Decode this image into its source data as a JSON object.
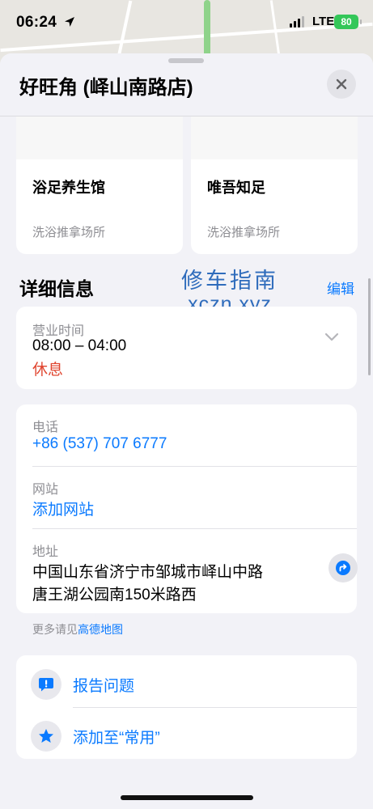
{
  "status_bar": {
    "time": "06:24",
    "network": "LTE",
    "battery": "80"
  },
  "place": {
    "title": "好旺角 (峄山南路店)"
  },
  "nearby": [
    {
      "name": "浴足养生馆",
      "category": "洗浴推拿场所"
    },
    {
      "name": "唯吾知足",
      "category": "洗浴推拿场所"
    }
  ],
  "details": {
    "title": "详细信息",
    "edit_label": "编辑",
    "hours": {
      "label": "营业时间",
      "value": "08:00 – 04:00",
      "status": "休息"
    },
    "phone": {
      "label": "电话",
      "value": "+86 (537) 707 6777"
    },
    "website": {
      "label": "网站",
      "value": "添加网站"
    },
    "address": {
      "label": "地址",
      "line1": "中国山东省济宁市邹城市峄山中路",
      "line2": "唐王湖公园南150米路西"
    },
    "more": {
      "prefix": "更多请见",
      "link": "高德地图"
    }
  },
  "actions": [
    {
      "label": "报告问题",
      "icon": "exclamation-bubble-icon"
    },
    {
      "label": "添加至“常用”",
      "icon": "star-icon"
    }
  ],
  "watermark": {
    "line1": "修车指南",
    "line2": "xczn.xyz"
  },
  "colors": {
    "accent": "#0a7aff",
    "closed": "#e0452f",
    "battery": "#34c759"
  }
}
